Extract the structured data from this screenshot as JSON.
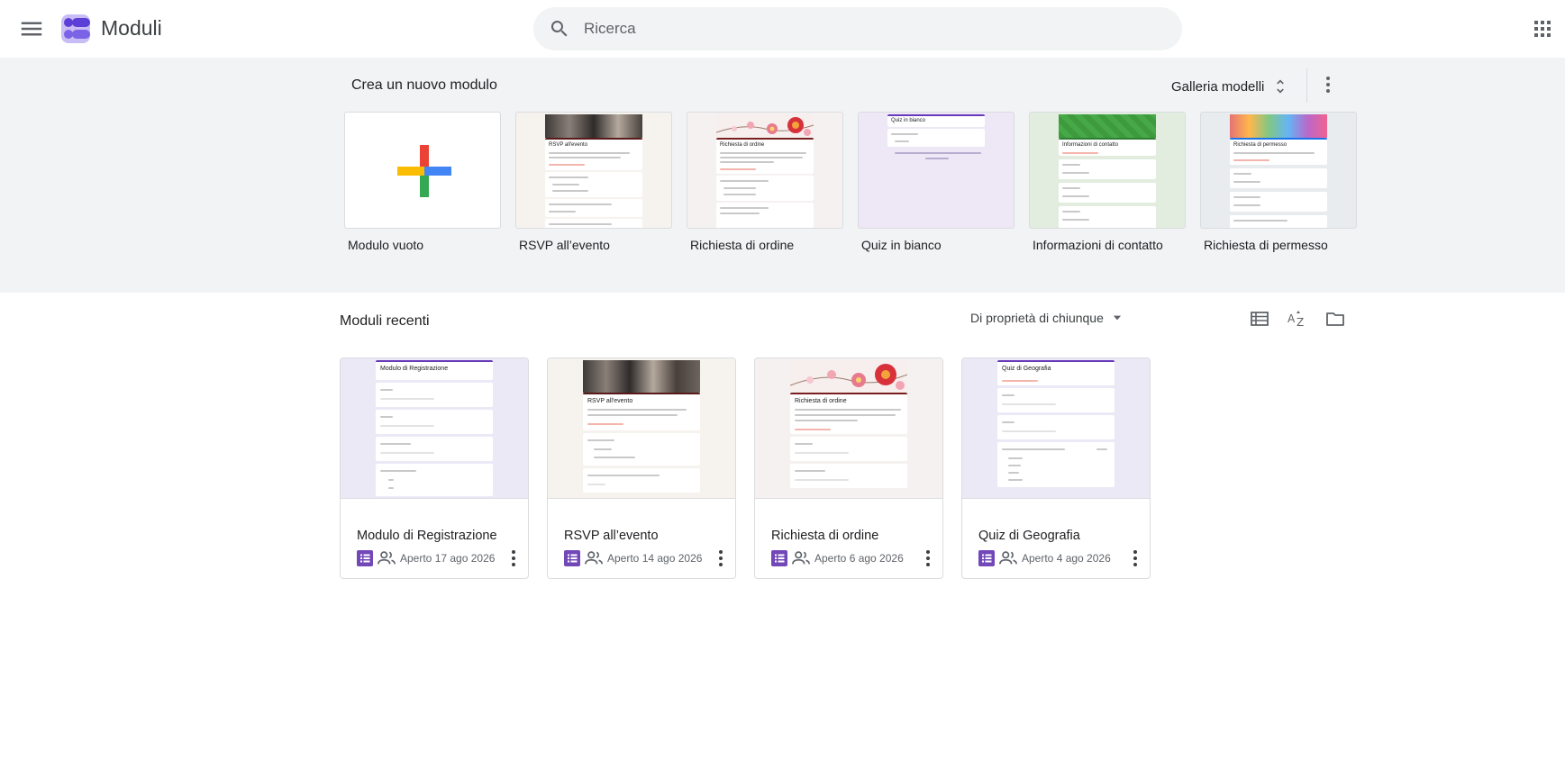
{
  "header": {
    "app_title": "Moduli",
    "search_placeholder": "Ricerca"
  },
  "templates": {
    "heading": "Crea un nuovo modulo",
    "gallery_label": "Galleria modelli",
    "items": [
      {
        "label": "Modulo vuoto",
        "thumb_title": ""
      },
      {
        "label": "RSVP all’evento",
        "thumb_title": "RSVP all'evento"
      },
      {
        "label": "Richiesta di ordine",
        "thumb_title": "Richiesta di ordine"
      },
      {
        "label": "Quiz in bianco",
        "thumb_title": "Quiz in bianco"
      },
      {
        "label": "Informazioni di contatto",
        "thumb_title": "Informazioni di contatto"
      },
      {
        "label": "Richiesta di permesso",
        "thumb_title": "Richiesta di permesso"
      }
    ]
  },
  "recent": {
    "heading": "Moduli recenti",
    "owner_filter": "Di proprietà di chiunque",
    "docs": [
      {
        "title": "Modulo di Registrazione",
        "date": "Aperto 17 ago 2026",
        "thumb_title": "Modulo di Registrazione"
      },
      {
        "title": "RSVP all’evento",
        "date": "Aperto 14 ago 2026",
        "thumb_title": "RSVP all'evento"
      },
      {
        "title": "Richiesta di ordine",
        "date": "Aperto 6 ago 2026",
        "thumb_title": "Richiesta di ordine"
      },
      {
        "title": "Quiz di Geografia",
        "date": "Aperto 4 ago 2026",
        "thumb_title": "Quiz di Geografia"
      }
    ]
  },
  "colors": {
    "forms_purple": "#7248b9",
    "page_bg_gray": "#f1f3f4",
    "rsvp_bg": "#f6f3ef",
    "order_bg": "#f5f1f1",
    "quiz_bg": "#ede7f6",
    "contact_bg": "#e2eddf",
    "permission_bg": "#e8ecee",
    "registration_bg": "#ece9f7"
  },
  "icons": [
    "menu-icon",
    "forms-logo",
    "search-icon",
    "apps-grid-icon",
    "unfold-icon",
    "more-vert-icon",
    "list-view-icon",
    "sort-az-icon",
    "folder-icon",
    "forms-file-icon",
    "shared-people-icon"
  ]
}
